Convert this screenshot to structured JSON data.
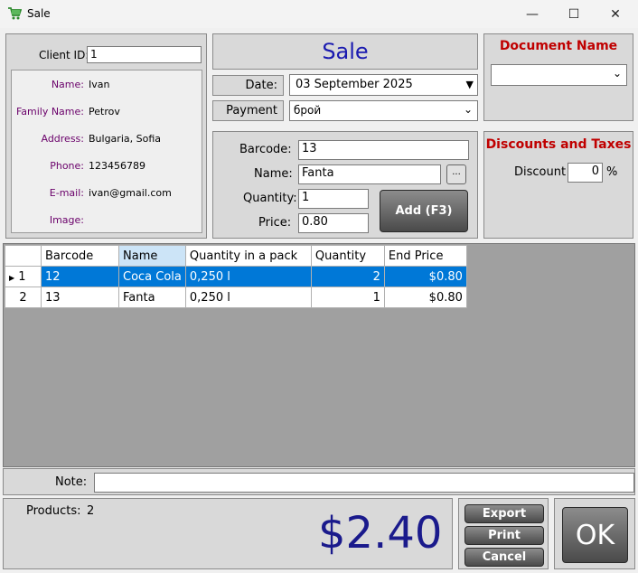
{
  "window": {
    "title": "Sale",
    "minimize": "—",
    "maximize": "☐",
    "close": "✕"
  },
  "client": {
    "id_label": "Client ID:",
    "id_value": "1",
    "name_label": "Name:",
    "name": "Ivan",
    "family_label": "Family Name:",
    "family": "Petrov",
    "address_label": "Address:",
    "address": "Bulgaria, Sofia",
    "phone_label": "Phone:",
    "phone": "123456789",
    "email_label": "E-mail:",
    "email": "ivan@gmail.com",
    "image_label": "Image:"
  },
  "header": {
    "title": "Sale",
    "date_label": "Date:",
    "date": "03 September 2025",
    "payment_label": "Payment",
    "payment": "брой"
  },
  "item": {
    "barcode_label": "Barcode:",
    "barcode": "13",
    "name_label": "Name:",
    "name": "Fanta",
    "browse": "...",
    "quantity_label": "Quantity:",
    "quantity": "1",
    "price_label": "Price:",
    "price": "0.80",
    "add": "Add (F3)"
  },
  "document": {
    "title": "Document Name",
    "value": ""
  },
  "discounts": {
    "title": "Discounts and Taxes",
    "discount_label": "Discount",
    "discount": "0",
    "percent": "%"
  },
  "grid": {
    "columns": [
      "Barcode",
      "Name",
      "Quantity in a pack",
      "Quantity",
      "End Price"
    ],
    "rows": [
      {
        "n": "1",
        "barcode": "12",
        "name": "Coca Cola",
        "pack": "0,250 l",
        "qty": "2",
        "price": "$0.80"
      },
      {
        "n": "2",
        "barcode": "13",
        "name": "Fanta",
        "pack": "0,250 l",
        "qty": "1",
        "price": "$0.80"
      }
    ]
  },
  "note": {
    "label": "Note:",
    "value": ""
  },
  "summary": {
    "products_label": "Products:",
    "products": "2",
    "total": "$2.40"
  },
  "actions": {
    "export": "Export",
    "print": "Print",
    "cancel": "Cancel",
    "ok": "OK"
  }
}
